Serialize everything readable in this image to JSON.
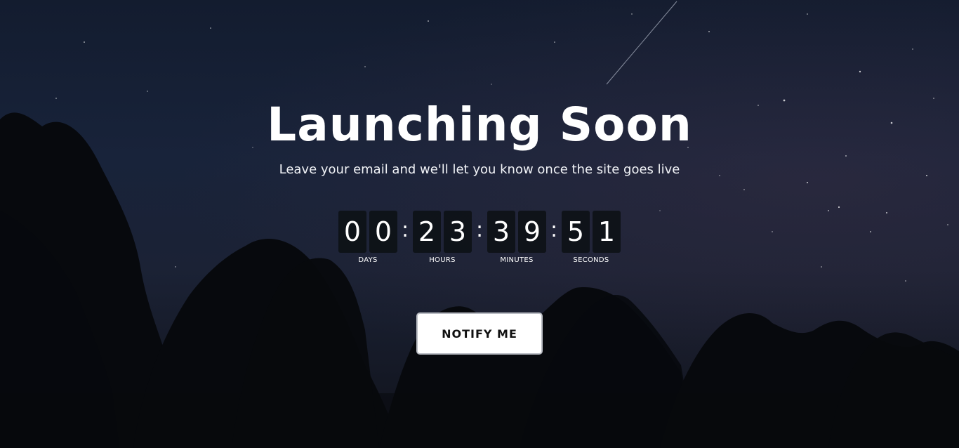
{
  "hero": {
    "title": "Launching Soon",
    "subtitle": "Leave your email and we'll let you know once the site goes live"
  },
  "countdown": {
    "days": {
      "digits": [
        "0",
        "0"
      ],
      "label": "DAYS"
    },
    "hours": {
      "digits": [
        "2",
        "3"
      ],
      "label": "HOURS"
    },
    "minutes": {
      "digits": [
        "3",
        "9"
      ],
      "label": "MINUTES"
    },
    "seconds": {
      "digits": [
        "5",
        "1"
      ],
      "label": "SECONDS"
    },
    "separator": ":"
  },
  "actions": {
    "notify_label": "NOTIFY ME"
  },
  "colors": {
    "sky_top": "#131c2f",
    "sky_bottom": "#10121a",
    "digit_bg": "#0c1114",
    "text": "#ffffff",
    "button_bg": "#ffffff",
    "button_text": "#111111"
  }
}
